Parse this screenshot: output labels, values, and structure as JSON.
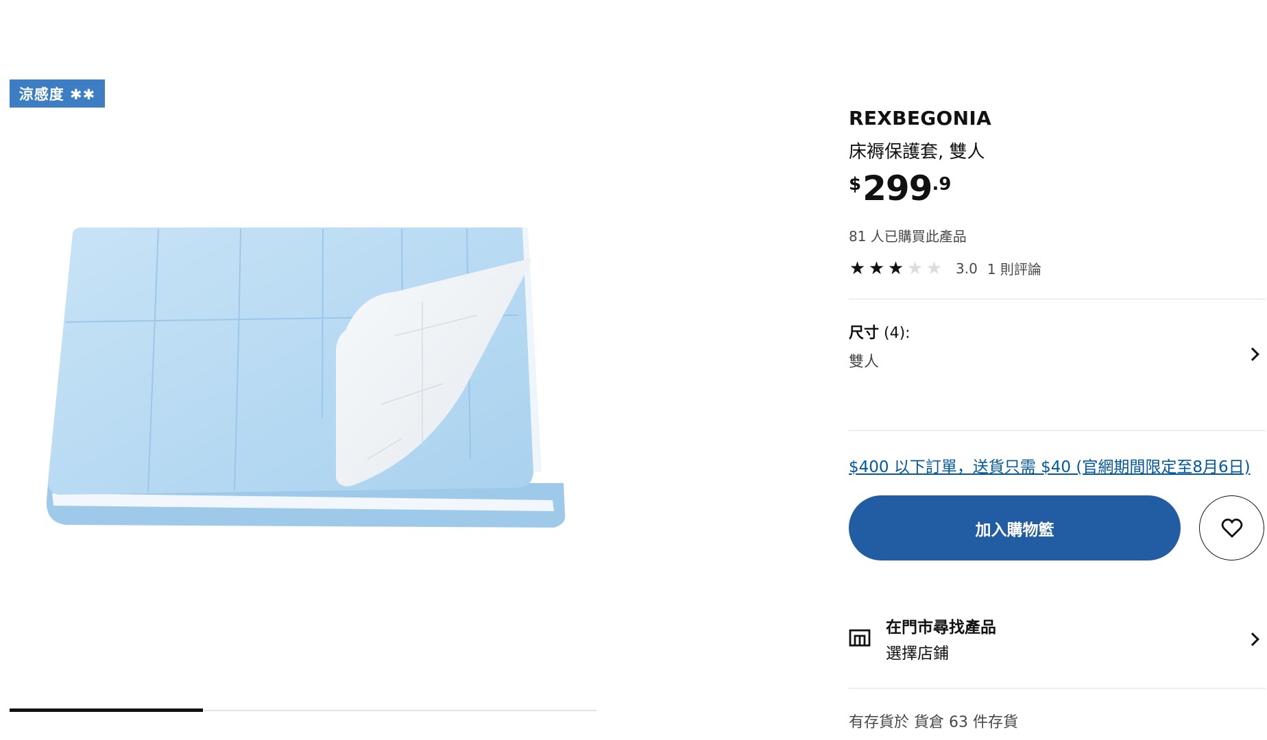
{
  "gallery": {
    "badge": "涼感度 ✱✱",
    "progress": 0.33
  },
  "product": {
    "brand": "REXBEGONIA",
    "description": "床褥保護套, 雙人",
    "price": {
      "currency": "$",
      "integer": "299",
      "decimal": ".9"
    },
    "purchased_text": "81 人已購買此產品",
    "rating": {
      "value": 3.0,
      "value_text": "3.0",
      "max": 5,
      "reviews_text": "1 則評論"
    }
  },
  "size": {
    "label": "尺寸",
    "count": "(4):",
    "value": "雙人"
  },
  "promo_link": "$400 以下訂單，送貨只需 $40 (官網期間限定至8月6日)",
  "actions": {
    "add_to_cart": "加入購物籃",
    "favorite_icon": "heart-icon"
  },
  "store": {
    "icon": "store-icon",
    "title": "在門市尋找產品",
    "subtitle": "選擇店鋪"
  },
  "stock_text": "有存貨於 貨倉 63 件存貨",
  "colors": {
    "accent_blue": "#225ca2",
    "badge_blue": "#3d7dc3",
    "link_blue": "#0058a3",
    "product_blue": "#b9dcf3"
  }
}
